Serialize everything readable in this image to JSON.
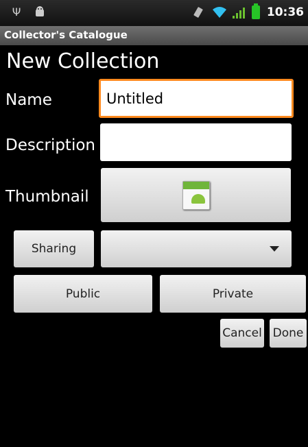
{
  "status_bar": {
    "time": "10:36"
  },
  "app": {
    "title": "Collector's Catalogue"
  },
  "form": {
    "heading": "New Collection",
    "name_label": "Name",
    "name_value": "Untitled",
    "description_label": "Description",
    "description_value": "",
    "thumbnail_label": "Thumbnail",
    "sharing_button": "Sharing",
    "sharing_selected": "",
    "public_button": "Public",
    "private_button": "Private",
    "cancel_button": "Cancel",
    "done_button": "Done"
  },
  "colors": {
    "focus_border": "#ff8a1f",
    "battery": "#27c427",
    "wifi": "#32c0f0"
  },
  "icons": [
    "usb-icon",
    "android-debug-icon",
    "vibrate-icon",
    "wifi-icon",
    "signal-icon",
    "battery-icon",
    "android-thumbnail-icon",
    "dropdown-arrow-icon"
  ]
}
